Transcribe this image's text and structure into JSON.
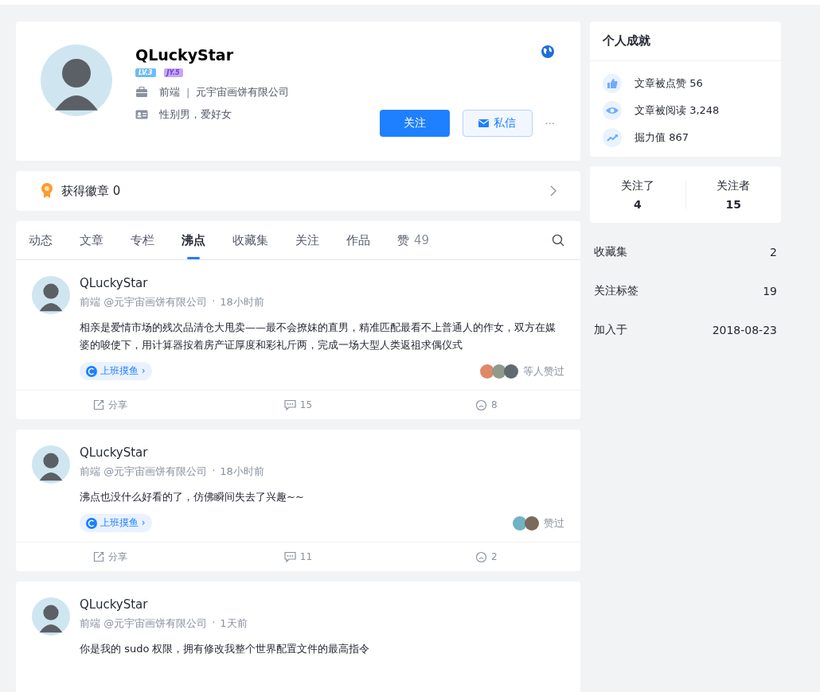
{
  "profile": {
    "name": "QLuckyStar",
    "badges": [
      {
        "kind": "level",
        "text": "LV.3"
      },
      {
        "kind": "jy",
        "text": "JY.5"
      }
    ],
    "job": {
      "position": "前端",
      "separator": "|",
      "company": "元宇宙画饼有限公司"
    },
    "bio": "性别男，爱好女",
    "follow_button": "关注",
    "message_button": "私信",
    "more": "···"
  },
  "badge_bar": {
    "label": "获得徽章 0"
  },
  "tabs": [
    {
      "label": "动态",
      "selected": false
    },
    {
      "label": "文章",
      "selected": false
    },
    {
      "label": "专栏",
      "selected": false
    },
    {
      "label": "沸点",
      "selected": true
    },
    {
      "label": "收藏集",
      "selected": false
    },
    {
      "label": "关注",
      "selected": false
    },
    {
      "label": "作品",
      "selected": false
    },
    {
      "label": "赞",
      "count": "49",
      "selected": false
    }
  ],
  "posts": [
    {
      "author": "QLuckyStar",
      "meta": "前端 @元宇宙画饼有限公司",
      "separator": "·",
      "time": "18小时前",
      "content": "相亲是爱情市场的残次品清仓大甩卖——最不会撩妹的直男，精准匹配最看不上普通人的作女，双方在媒婆的唆使下，用计算器按着房产证厚度和彩礼斤两，完成一场大型人类返祖求偶仪式",
      "tag": "上班摸鱼 ›",
      "likers": [
        {
          "color": "#e0876a"
        },
        {
          "color": "#8f9a8a"
        },
        {
          "color": "#5f6b70"
        }
      ],
      "liked_text": "等人赞过",
      "share": "分享",
      "comments": "15",
      "likes": "8"
    },
    {
      "author": "QLuckyStar",
      "meta": "前端 @元宇宙画饼有限公司",
      "separator": "·",
      "time": "18小时前",
      "content": "沸点也没什么好看的了，仿佛瞬间失去了兴趣~~",
      "tag": "上班摸鱼 ›",
      "likers": [
        {
          "color": "#6fb3c4"
        },
        {
          "color": "#7a6a5a"
        }
      ],
      "liked_text": "赞过",
      "share": "分享",
      "comments": "11",
      "likes": "2"
    },
    {
      "author": "QLuckyStar",
      "meta": "前端 @元宇宙画饼有限公司",
      "separator": "·",
      "time": "1天前",
      "content": "你是我的 sudo 权限，拥有修改我整个世界配置文件的最高指令"
    }
  ],
  "achievements": {
    "title": "个人成就",
    "items": [
      {
        "kind": "like",
        "text": "文章被点赞 56"
      },
      {
        "kind": "view",
        "text": "文章被阅读 3,248"
      },
      {
        "kind": "power",
        "text": "掘力值 867"
      }
    ]
  },
  "follow_stats": [
    {
      "label": "关注了",
      "value": "4"
    },
    {
      "label": "关注者",
      "value": "15"
    }
  ],
  "info_list": [
    {
      "label": "收藏集",
      "value": "2"
    },
    {
      "label": "关注标签",
      "value": "19"
    },
    {
      "label": "加入于",
      "value": "2018-08-23"
    }
  ]
}
